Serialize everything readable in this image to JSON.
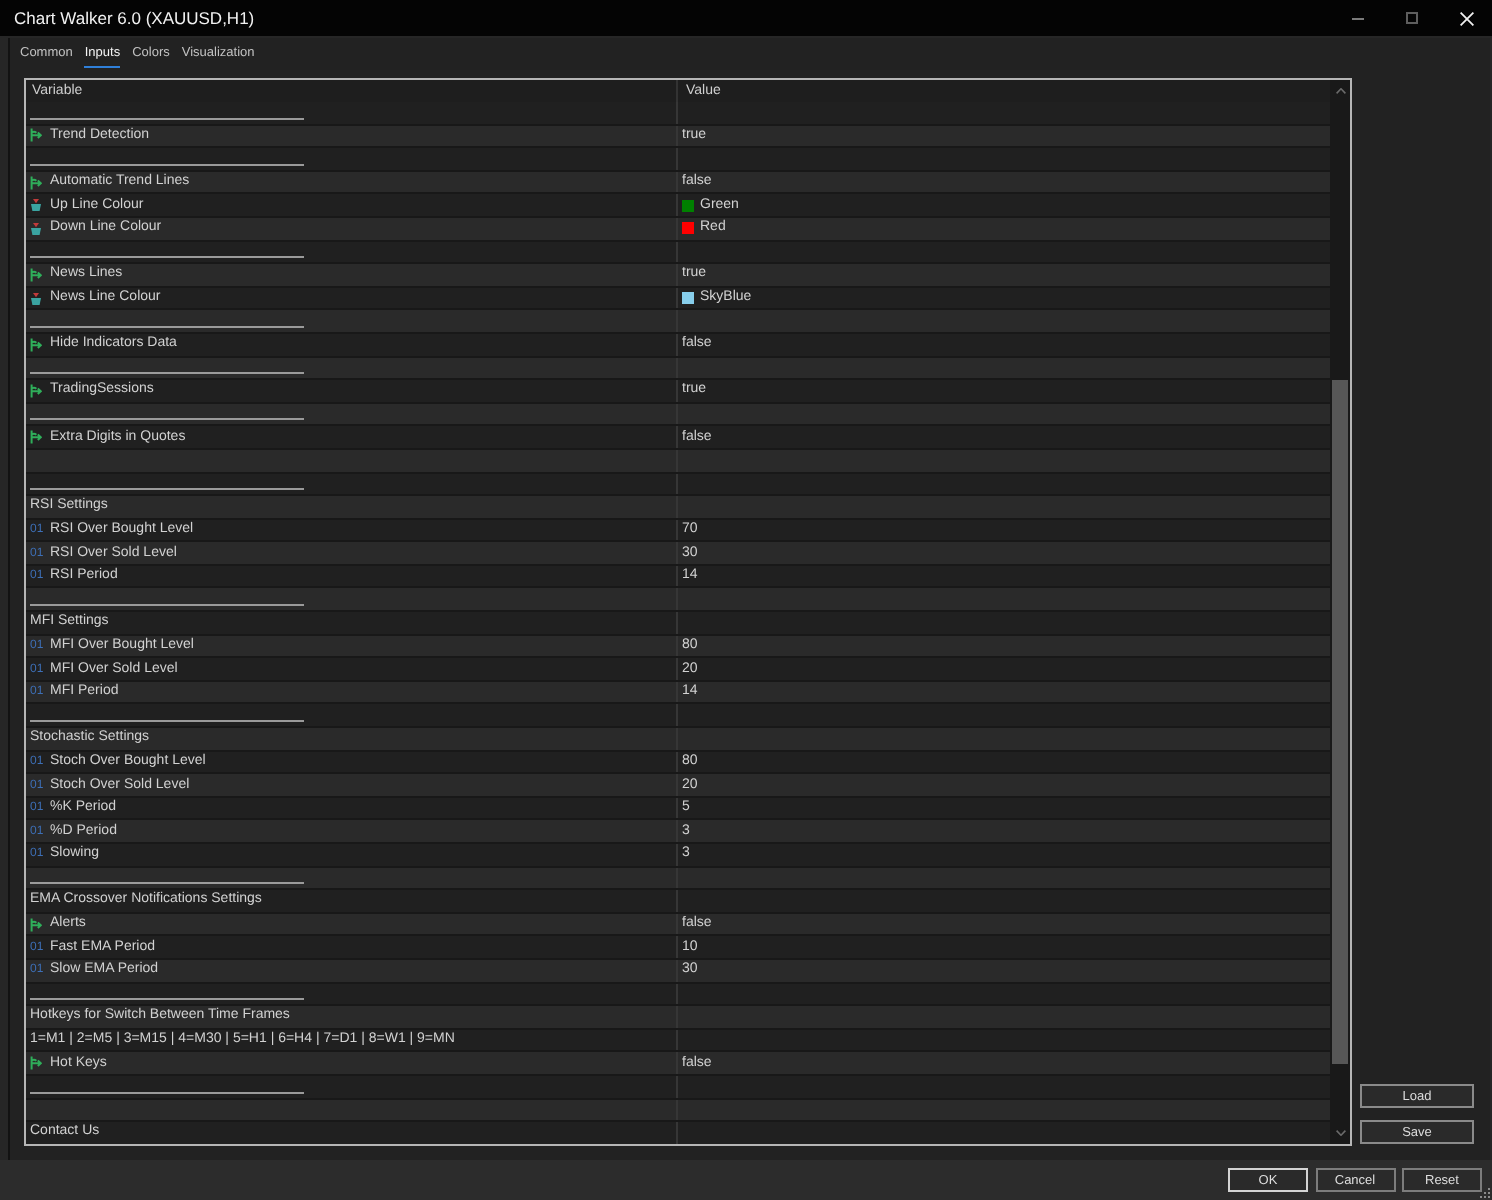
{
  "window": {
    "title": "Chart Walker 6.0 (XAUUSD,H1)"
  },
  "tabs": [
    {
      "label": "Common",
      "selected": false
    },
    {
      "label": "Inputs",
      "selected": true
    },
    {
      "label": "Colors",
      "selected": false
    },
    {
      "label": "Visualization",
      "selected": false
    }
  ],
  "table": {
    "columns": [
      "Variable",
      "Value"
    ],
    "rows": [
      {
        "kind": "separator"
      },
      {
        "kind": "bool",
        "name": "Trend Detection",
        "value": "true"
      },
      {
        "kind": "separator"
      },
      {
        "kind": "bool",
        "name": "Automatic Trend Lines",
        "value": "false"
      },
      {
        "kind": "color",
        "name": "Up Line Colour",
        "value": "Green",
        "color": "#008000"
      },
      {
        "kind": "color",
        "name": "Down Line Colour",
        "value": "Red",
        "color": "#ff0000"
      },
      {
        "kind": "separator"
      },
      {
        "kind": "bool",
        "name": "News Lines",
        "value": "true"
      },
      {
        "kind": "color",
        "name": "News Line Colour",
        "value": "SkyBlue",
        "color": "#87ceeb"
      },
      {
        "kind": "separator"
      },
      {
        "kind": "bool",
        "name": "Hide Indicators Data",
        "value": "false"
      },
      {
        "kind": "separator"
      },
      {
        "kind": "bool",
        "name": "TradingSessions",
        "value": "true"
      },
      {
        "kind": "separator"
      },
      {
        "kind": "bool",
        "name": "Extra Digits in Quotes",
        "value": "false"
      },
      {
        "kind": "blank"
      },
      {
        "kind": "separator"
      },
      {
        "kind": "heading",
        "name": "RSI Settings"
      },
      {
        "kind": "int",
        "type_label": "01",
        "name": "RSI Over Bought Level",
        "value": "70"
      },
      {
        "kind": "int",
        "type_label": "01",
        "name": "RSI Over Sold Level",
        "value": "30"
      },
      {
        "kind": "int",
        "type_label": "01",
        "name": "RSI Period",
        "value": "14"
      },
      {
        "kind": "separator"
      },
      {
        "kind": "heading",
        "name": "MFI Settings"
      },
      {
        "kind": "int",
        "type_label": "01",
        "name": "MFI Over Bought Level",
        "value": "80"
      },
      {
        "kind": "int",
        "type_label": "01",
        "name": "MFI Over Sold Level",
        "value": "20"
      },
      {
        "kind": "int",
        "type_label": "01",
        "name": "MFI Period",
        "value": "14"
      },
      {
        "kind": "separator"
      },
      {
        "kind": "heading",
        "name": "Stochastic Settings"
      },
      {
        "kind": "int",
        "type_label": "01",
        "name": "Stoch Over Bought Level",
        "value": "80"
      },
      {
        "kind": "int",
        "type_label": "01",
        "name": "Stoch Over Sold Level",
        "value": "20"
      },
      {
        "kind": "int",
        "type_label": "01",
        "name": "%K Period",
        "value": "5"
      },
      {
        "kind": "int",
        "type_label": "01",
        "name": "%D Period",
        "value": "3"
      },
      {
        "kind": "int",
        "type_label": "01",
        "name": "Slowing",
        "value": "3"
      },
      {
        "kind": "separator"
      },
      {
        "kind": "heading",
        "name": "EMA Crossover Notifications Settings"
      },
      {
        "kind": "bool",
        "name": "Alerts",
        "value": "false"
      },
      {
        "kind": "int",
        "type_label": "01",
        "name": "Fast EMA Period",
        "value": "10"
      },
      {
        "kind": "int",
        "type_label": "01",
        "name": "Slow EMA Period",
        "value": "30"
      },
      {
        "kind": "separator"
      },
      {
        "kind": "heading",
        "name": "Hotkeys for Switch Between Time Frames"
      },
      {
        "kind": "text",
        "name": "1=M1 | 2=M5 | 3=M15 | 4=M30 | 5=H1 | 6=H4 | 7=D1 | 8=W1 | 9=MN"
      },
      {
        "kind": "bool",
        "name": "Hot Keys",
        "value": "false"
      },
      {
        "kind": "separator"
      },
      {
        "kind": "blank"
      },
      {
        "kind": "heading",
        "name": "Contact Us"
      }
    ]
  },
  "side_buttons": [
    "Load",
    "Save"
  ],
  "buttons": [
    {
      "label": "OK",
      "default": true
    },
    {
      "label": "Cancel",
      "default": false
    },
    {
      "label": "Reset",
      "default": false
    }
  ]
}
